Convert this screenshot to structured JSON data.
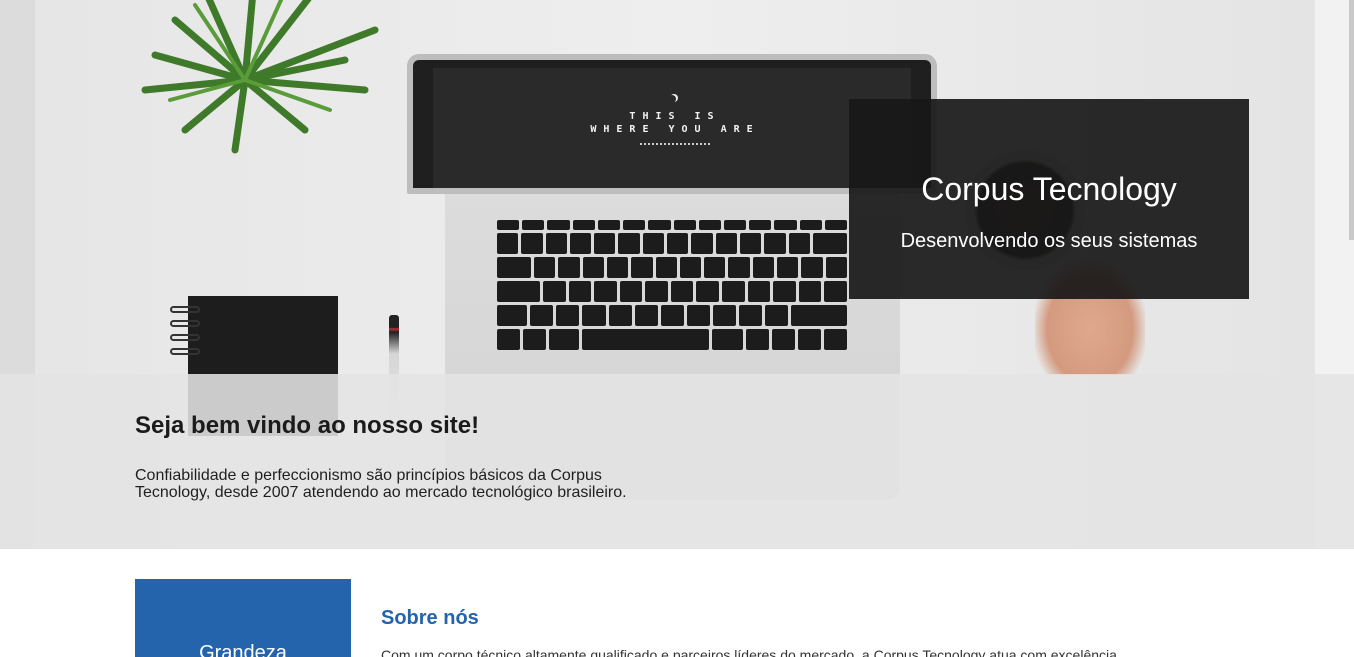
{
  "hero": {
    "screen_text_line1": "THIS IS",
    "screen_text_line2": "WHERE YOU ARE",
    "brand_title": "Corpus Tecnology",
    "brand_subtitle": "Desenvolvendo os seus sistemas"
  },
  "welcome": {
    "title": "Seja bem vindo ao nosso site!",
    "text": "Confiabilidade e perfeccionismo são princípios básicos da Corpus Tecnology, desde 2007 atendendo ao mercado tecnológico brasileiro."
  },
  "feature": {
    "label": "Grandeza"
  },
  "about": {
    "title": "Sobre nós",
    "text": "Com um corpo técnico altamente qualificado e parceiros líderes do mercado, a Corpus Tecnology atua com excelência"
  },
  "colors": {
    "accent": "#2464ad",
    "brand_box": "#181818"
  }
}
